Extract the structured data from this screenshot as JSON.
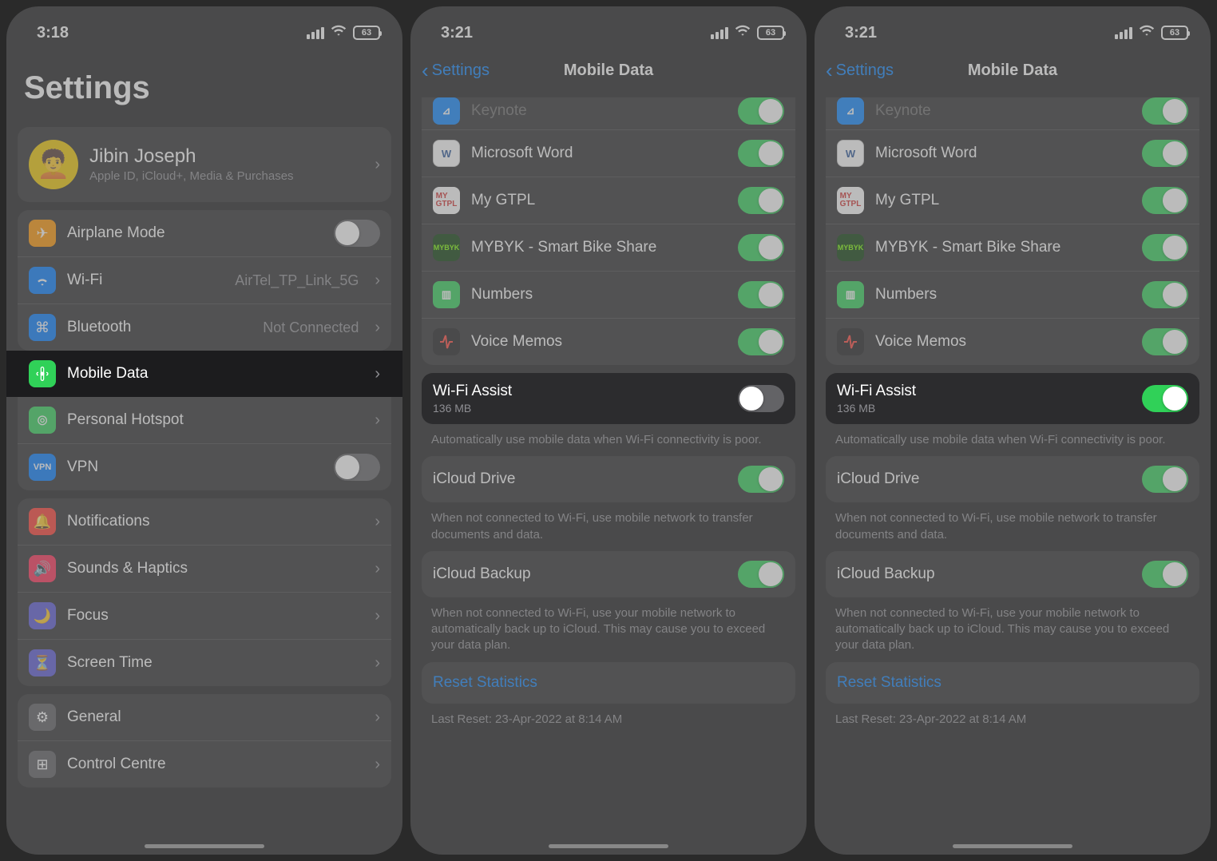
{
  "statusBar": {
    "time1": "3:18",
    "time2": "3:21",
    "time3": "3:21",
    "battery": "63"
  },
  "settings": {
    "title": "Settings",
    "profile": {
      "name": "Jibin Joseph",
      "subtitle": "Apple ID, iCloud+, Media & Purchases"
    },
    "group1": {
      "airplane": "Airplane Mode",
      "wifi": "Wi-Fi",
      "wifiDetail": "AirTel_TP_Link_5G",
      "bluetooth": "Bluetooth",
      "bluetoothDetail": "Not Connected",
      "mobile": "Mobile Data",
      "hotspot": "Personal Hotspot",
      "vpn": "VPN",
      "vpnIcon": "VPN"
    },
    "group2": {
      "notifications": "Notifications",
      "sounds": "Sounds & Haptics",
      "focus": "Focus",
      "screentime": "Screen Time"
    },
    "group3": {
      "general": "General",
      "control": "Control Centre"
    }
  },
  "mobile": {
    "backLabel": "Settings",
    "title": "Mobile Data",
    "apps": {
      "keynote": "Keynote",
      "word": "Microsoft Word",
      "gtpl": "My GTPL",
      "mybyk": "MYBYK - Smart Bike Share",
      "numbers": "Numbers",
      "voice": "Voice Memos"
    },
    "wifiAssist": {
      "title": "Wi-Fi Assist",
      "sub": "136 MB",
      "footer": "Automatically use mobile data when Wi-Fi connectivity is poor."
    },
    "icloudDrive": {
      "title": "iCloud Drive",
      "footer": "When not connected to Wi-Fi, use mobile network to transfer documents and data."
    },
    "icloudBackup": {
      "title": "iCloud Backup",
      "footer": "When not connected to Wi-Fi, use your mobile network to automatically back up to iCloud. This may cause you to exceed your data plan."
    },
    "reset": "Reset Statistics",
    "lastReset": "Last Reset: 23-Apr-2022 at 8:14 AM"
  },
  "icons": {
    "gtplText": "MY\nGTPL",
    "wordText": "W",
    "mybykText": "MYBYK"
  }
}
